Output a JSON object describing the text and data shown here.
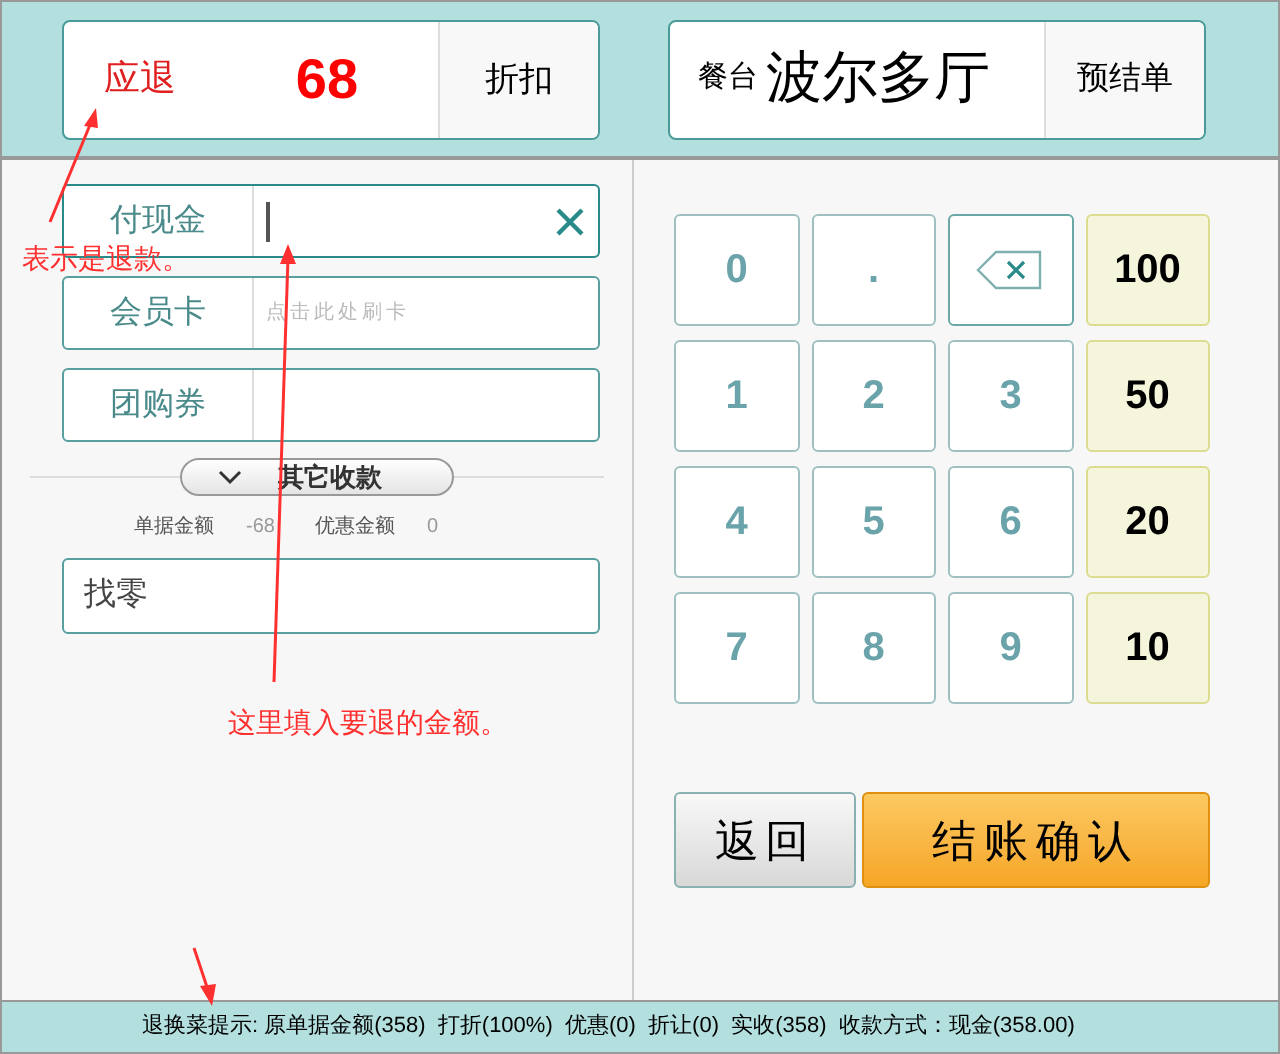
{
  "top_left": {
    "label": "应退",
    "amount": "68",
    "button": "折扣"
  },
  "top_right": {
    "label": "餐台",
    "table": "波尔多厅",
    "button": "预结单"
  },
  "payment_fields": [
    {
      "label": "付现金",
      "focused": true,
      "clearable": true
    },
    {
      "label": "会员卡",
      "placeholder": "点击此处刷卡",
      "focused": false,
      "clearable": false
    },
    {
      "label": "团购券",
      "focused": false,
      "clearable": false
    }
  ],
  "other_payments": {
    "label": "其它收款",
    "expanded": false
  },
  "summary": [
    {
      "label": "单据金额",
      "value": "-68"
    },
    {
      "label": "优惠金额",
      "value": "0"
    }
  ],
  "change_field": {
    "label": "找零"
  },
  "keypad": [
    {
      "kind": "digit",
      "label": "0"
    },
    {
      "kind": "digit",
      "label": "."
    },
    {
      "kind": "backspace"
    },
    {
      "kind": "amount",
      "label": "100"
    },
    {
      "kind": "digit",
      "label": "1"
    },
    {
      "kind": "digit",
      "label": "2"
    },
    {
      "kind": "digit",
      "label": "3"
    },
    {
      "kind": "amount",
      "label": "50"
    },
    {
      "kind": "digit",
      "label": "4"
    },
    {
      "kind": "digit",
      "label": "5"
    },
    {
      "kind": "digit",
      "label": "6"
    },
    {
      "kind": "amount",
      "label": "20"
    },
    {
      "kind": "digit",
      "label": "7"
    },
    {
      "kind": "digit",
      "label": "8"
    },
    {
      "kind": "digit",
      "label": "9"
    },
    {
      "kind": "amount",
      "label": "10"
    }
  ],
  "actions": [
    {
      "kind": "back",
      "label": "返回"
    },
    {
      "kind": "confirm",
      "label": "结账确认"
    }
  ],
  "annotations": [
    "表示是退款。",
    "这里填入要退的金额。"
  ],
  "status_bar": "退换菜提示: 原单据金额(358)  打折(100%)  优惠(0)  折让(0)  实收(358)  收款方式：现金(358.00)"
}
